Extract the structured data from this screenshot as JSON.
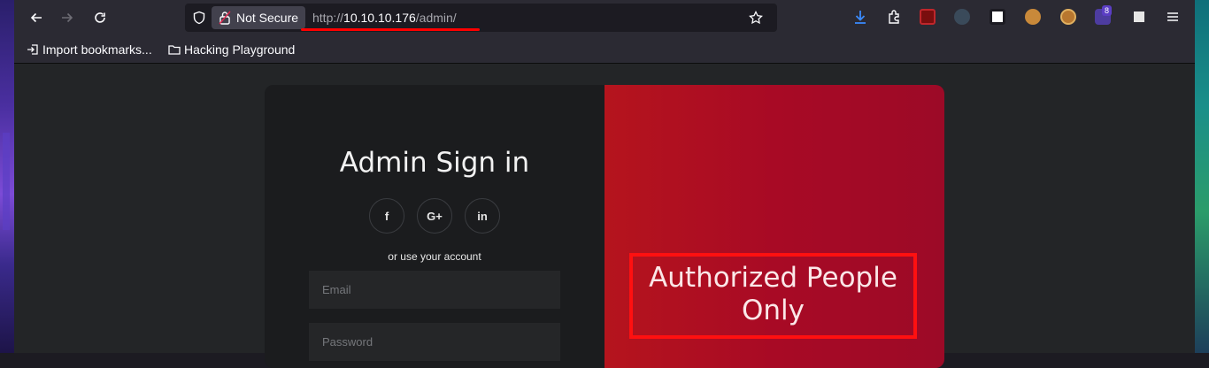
{
  "browser": {
    "security_label": "Not Secure",
    "url_scheme": "http://",
    "url_host": "10.10.10.176",
    "url_path": "/admin/",
    "extensions_badge": "8"
  },
  "bookmarks": [
    {
      "label": "Import bookmarks...",
      "icon": "import-icon"
    },
    {
      "label": "Hacking Playground",
      "icon": "folder-icon"
    }
  ],
  "page": {
    "title": "Admin Sign in",
    "social": [
      {
        "label": "f",
        "icon": "facebook-icon"
      },
      {
        "label": "G+",
        "icon": "google-plus-icon"
      },
      {
        "label": "in",
        "icon": "linkedin-icon"
      }
    ],
    "or_text": "or use your account",
    "email_placeholder": "Email",
    "password_placeholder": "Password",
    "panel_text": "Authorized People Only"
  },
  "colors": {
    "accent_red": "#ff1010",
    "panel_red": "#a80a25"
  }
}
